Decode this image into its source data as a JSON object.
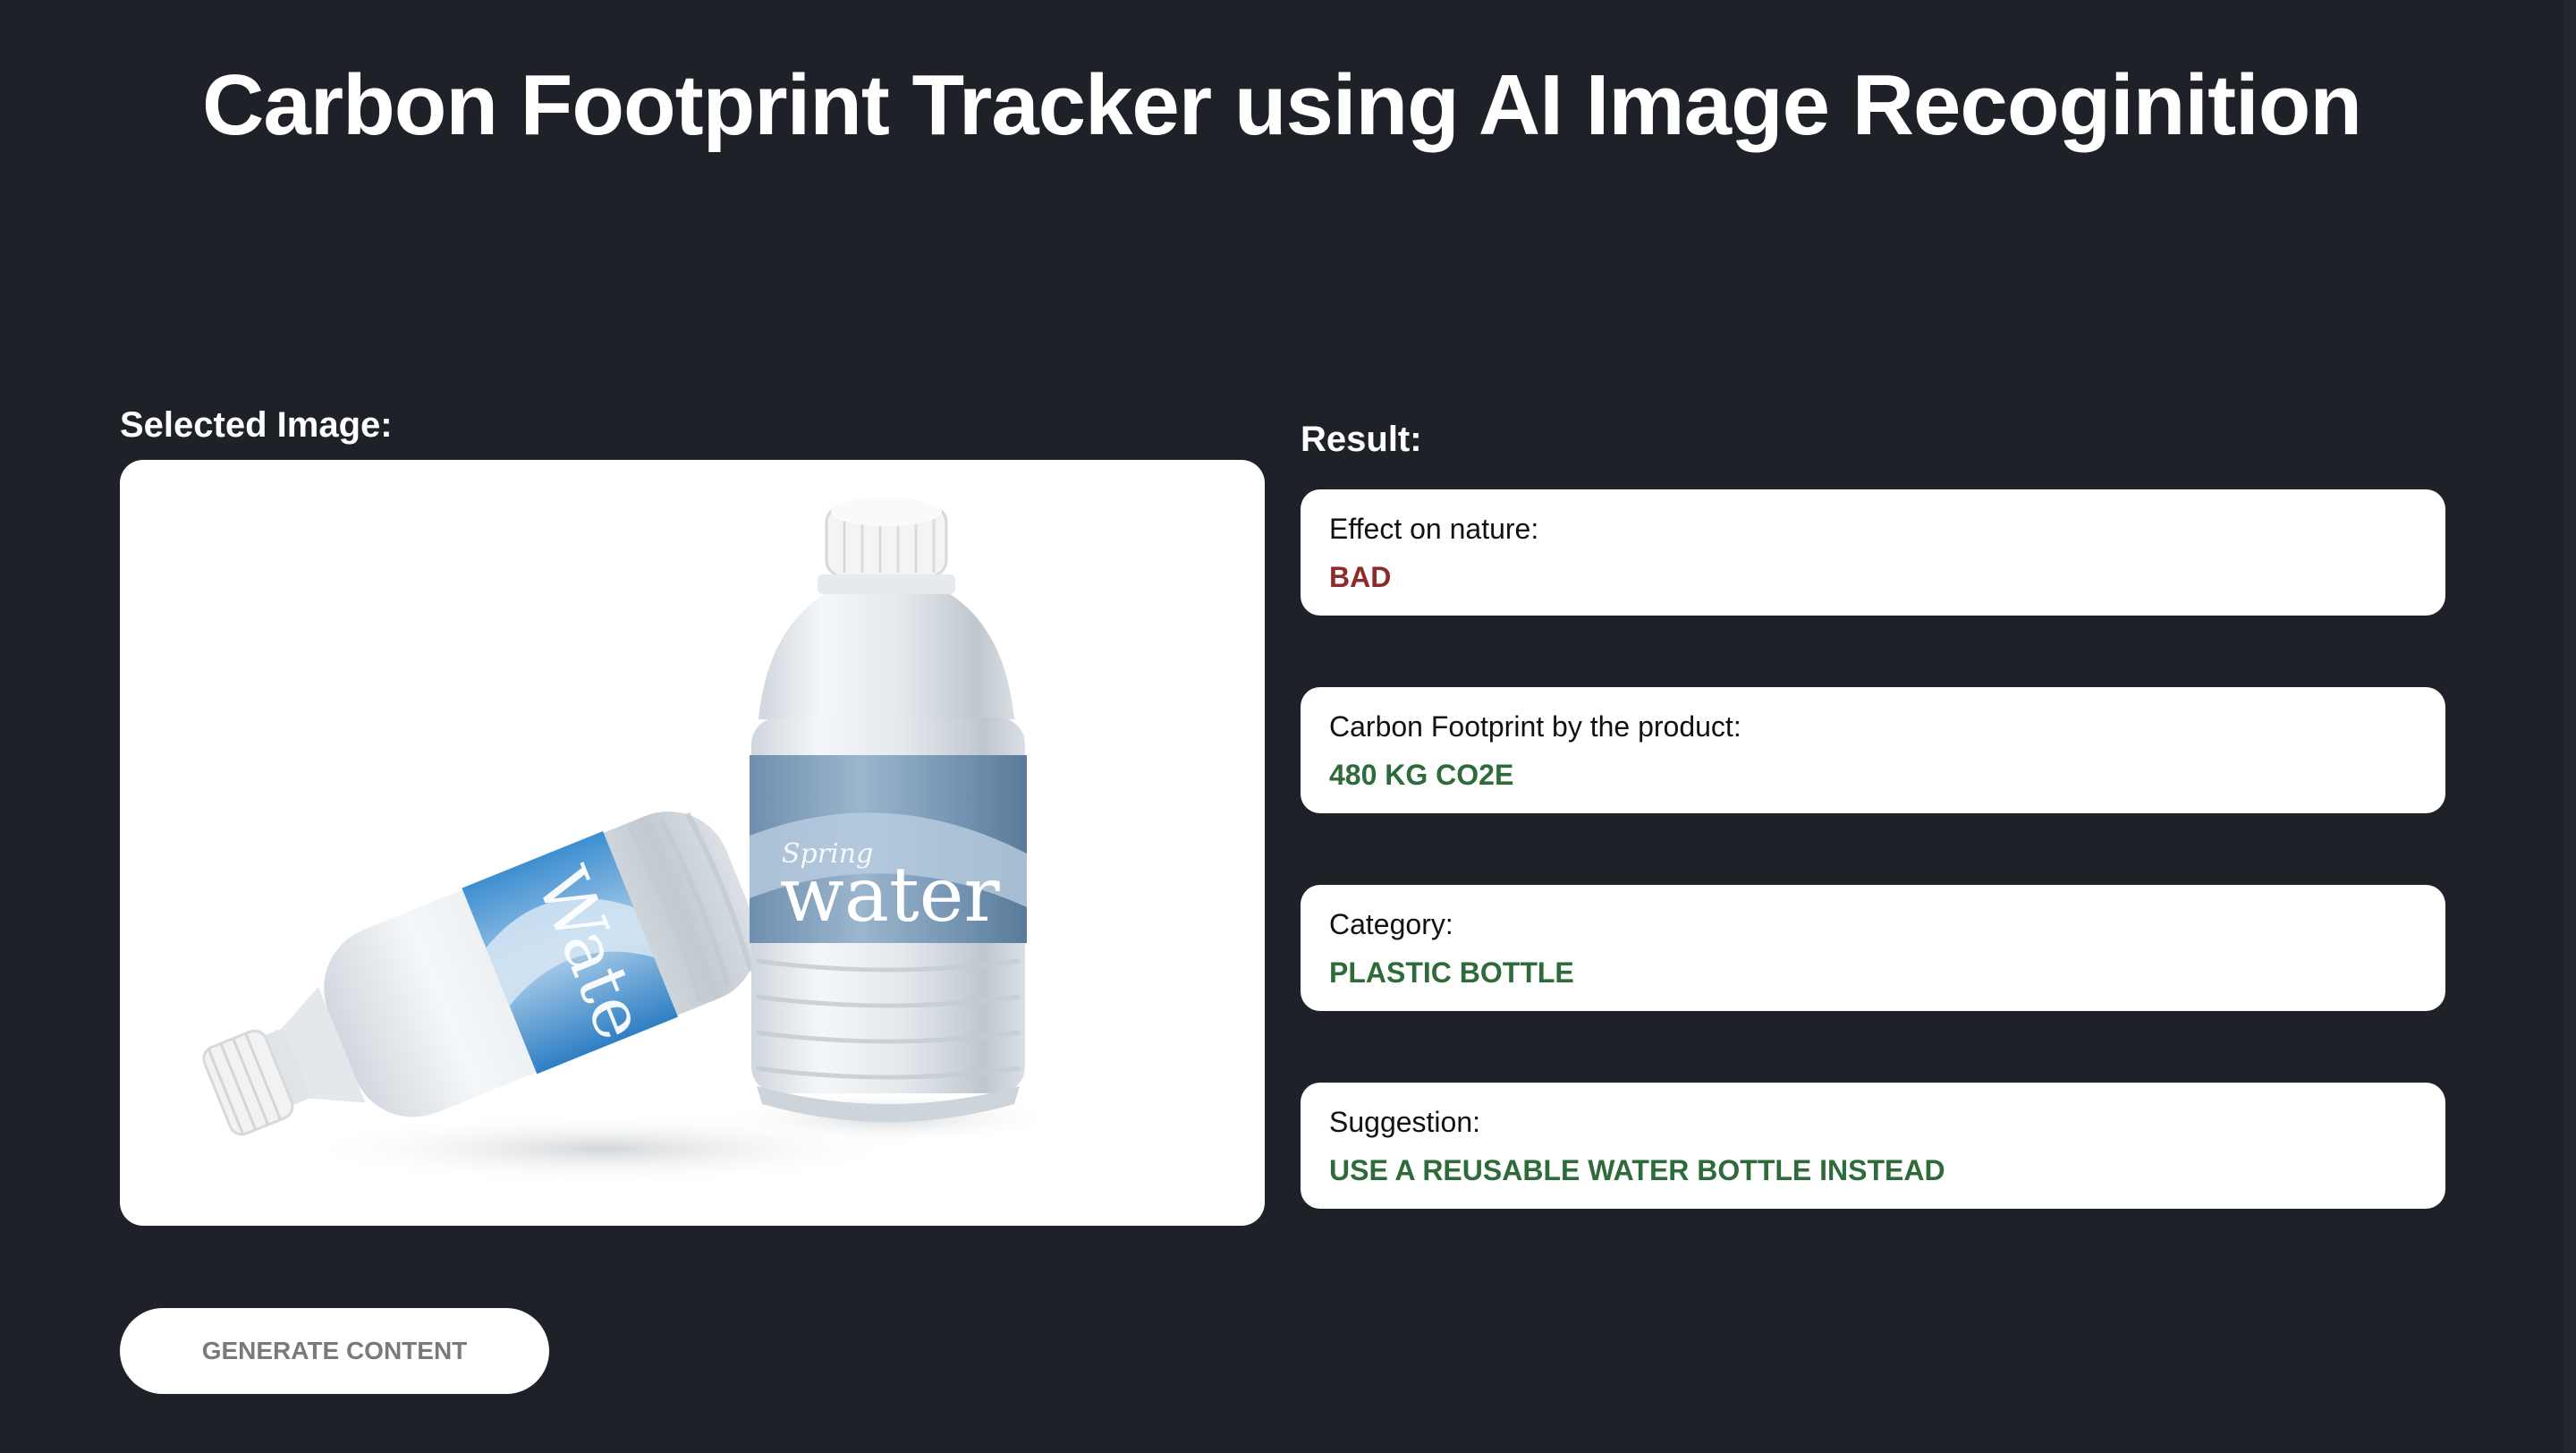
{
  "header": {
    "title": "Carbon Footprint Tracker using AI Image Recoginition"
  },
  "image_panel": {
    "label": "Selected Image:",
    "image_description_icon": "water-bottles-image",
    "label_text_big": "water",
    "label_text_small": "Spring"
  },
  "result_panel": {
    "label": "Result:",
    "items": [
      {
        "key": "Effect on nature:",
        "value": "BAD",
        "status": "bad"
      },
      {
        "key": "Carbon Footprint by the product:",
        "value": "480 KG CO2E",
        "status": "good"
      },
      {
        "key": "Category:",
        "value": "PLASTIC BOTTLE",
        "status": "good"
      },
      {
        "key": "Suggestion:",
        "value": "USE A REUSABLE WATER BOTTLE INSTEAD",
        "status": "good"
      }
    ]
  },
  "actions": {
    "generate_label": "GENERATE CONTENT"
  },
  "colors": {
    "background": "#1e2128",
    "bad": "#8e2a2a",
    "good": "#2e6b3a",
    "card": "#ffffff"
  }
}
